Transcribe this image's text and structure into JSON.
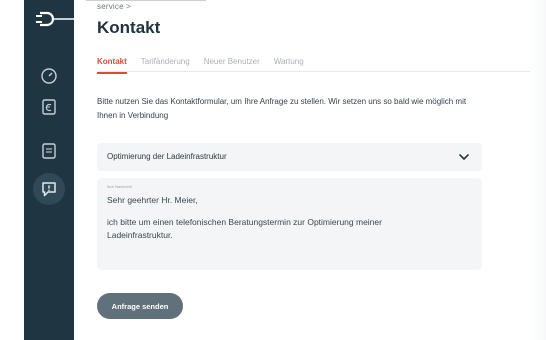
{
  "colors": {
    "sidebar": "#1f3542",
    "accent": "#d94b3c",
    "button": "#60717c",
    "field": "#f3f5f6"
  },
  "sidebar": {
    "icons": [
      "plug-logo-icon",
      "gauge-icon",
      "document-euro-icon",
      "document-icon",
      "chat-icon"
    ],
    "active_icon": "chat-icon"
  },
  "header": {
    "breadcrumb": "service >",
    "title": "Kontakt"
  },
  "tabs": [
    {
      "label": "Kontakt",
      "active": true
    },
    {
      "label": "Tarifänderung",
      "active": false
    },
    {
      "label": "Neuer Benutzer",
      "active": false
    },
    {
      "label": "Wartung",
      "active": false
    }
  ],
  "intro": "Bitte nutzen Sie das Kontaktformular, um Ihre Anfrage zu stellen. Wir setzen uns so bald wie möglich mit Ihnen in Verbindung",
  "subject_select": {
    "value": "Optimierung der Ladeinfrastruktur",
    "icon": "chevron-down-icon"
  },
  "message": {
    "label": "Ihre Nachricht",
    "lines": [
      "Sehr geehrter Hr. Meier,",
      "ich bitte um einen telefonischen Beratungstermin zur Optimierung meiner",
      "Ladeinfrastruktur."
    ]
  },
  "send_button": "Anfrage senden"
}
